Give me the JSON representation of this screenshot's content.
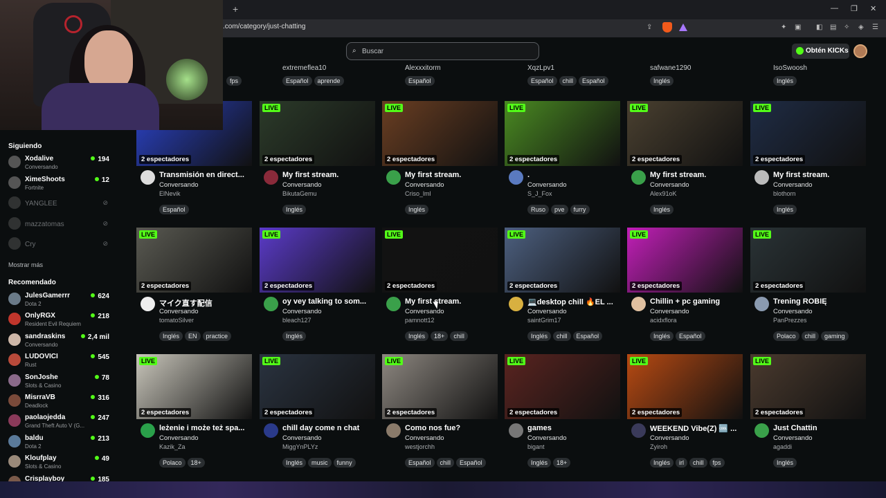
{
  "browser": {
    "url": ".com/category/just-chatting",
    "new_tab": "+",
    "minimize": "—",
    "maximize": "❐",
    "close": "✕"
  },
  "header": {
    "search_placeholder": "Buscar",
    "search_icon": "search-icon",
    "kicks_button": "Obtén KICKs"
  },
  "sidebar": {
    "following_label": "Siguiendo",
    "following": [
      {
        "name": "Xodalive",
        "category": "Conversando",
        "viewers": "194"
      },
      {
        "name": "XimeShoots",
        "category": "Fortnite",
        "viewers": "12"
      },
      {
        "name": "YANGLEE",
        "offline": true
      },
      {
        "name": "mazzatomas",
        "offline": true
      },
      {
        "name": "Cry",
        "offline": true
      }
    ],
    "show_more": "Mostrar más",
    "recommended_label": "Recomendado",
    "recommended": [
      {
        "name": "JulesGamerrr",
        "category": "Dota 2",
        "viewers": "624"
      },
      {
        "name": "OnlyRGX",
        "category": "Resident Evil Requiem",
        "viewers": "218"
      },
      {
        "name": "sandraskins",
        "category": "Conversando",
        "viewers": "2,4 mil"
      },
      {
        "name": "LUDOVICI",
        "category": "Rust",
        "viewers": "545"
      },
      {
        "name": "SonJoshe",
        "category": "Slots & Casino",
        "viewers": "78"
      },
      {
        "name": "MisrraVB",
        "category": "Deadlock",
        "viewers": "316"
      },
      {
        "name": "paolaojedda",
        "category": "Grand Theft Auto V (G...",
        "viewers": "247"
      },
      {
        "name": "baldu",
        "category": "Dota 2",
        "viewers": "213"
      },
      {
        "name": "Kloufplay",
        "category": "Slots & Casino",
        "viewers": "49"
      },
      {
        "name": "Crisplayboy",
        "category": "",
        "viewers": "185"
      }
    ]
  },
  "top_partial_row": [
    {
      "user": "",
      "tags": [
        "fps"
      ]
    },
    {
      "user": "extremeflea10",
      "tags": [
        "Español",
        "aprende"
      ]
    },
    {
      "user": "Alexxxitorm",
      "tags": [
        "Español"
      ]
    },
    {
      "user": "XqzLpv1",
      "tags": [
        "Español",
        "chill",
        "Español"
      ]
    },
    {
      "user": "safwane1290",
      "tags": [
        "Inglés"
      ]
    },
    {
      "user": "IsoSwoosh",
      "tags": [
        "Inglés"
      ]
    }
  ],
  "live_label": "LIVE",
  "streams": [
    [
      {
        "title": "Transmisión en direct...",
        "category": "Conversando",
        "user": "ElNevik",
        "viewers": "2 espectadores",
        "tags": [
          "Español"
        ],
        "live": false,
        "thumb": "#2b43c9"
      },
      {
        "title": "My first stream.",
        "category": "Conversando",
        "user": "BikutaGemu",
        "viewers": "2 espectadores",
        "tags": [
          "Inglés"
        ],
        "live": true,
        "thumb": "#2c3b2a"
      },
      {
        "title": "My first stream.",
        "category": "Conversando",
        "user": "Criso_lml",
        "viewers": "2 espectadores",
        "tags": [
          "Inglés"
        ],
        "live": true,
        "thumb": "#6a3e22"
      },
      {
        "title": ".",
        "category": "Conversando",
        "user": "S_J_Fox",
        "viewers": "2 espectadores",
        "tags": [
          "Ruso",
          "pve",
          "furry"
        ],
        "live": true,
        "thumb": "#4a8a22"
      },
      {
        "title": "My first stream.",
        "category": "Conversando",
        "user": "Alex91oK",
        "viewers": "2 espectadores",
        "tags": [
          "Inglés"
        ],
        "live": true,
        "thumb": "#4a4030"
      },
      {
        "title": "My first stream.",
        "category": "Conversando",
        "user": "blothorn",
        "viewers": "2 espectadores",
        "tags": [
          "Inglés"
        ],
        "live": true,
        "thumb": "#1f2c45"
      }
    ],
    [
      {
        "title": "マイク直す配信",
        "category": "Conversando",
        "user": "tomatoSilver",
        "viewers": "2 espectadores",
        "tags": [
          "Inglés",
          "EN",
          "practice"
        ],
        "live": true,
        "thumb": "#5a5a52"
      },
      {
        "title": "oy vey talking to som...",
        "category": "Conversando",
        "user": "bleach127",
        "viewers": "2 espectadores",
        "tags": [
          "Inglés"
        ],
        "live": true,
        "thumb": "#5b3bc9"
      },
      {
        "title": "My first stream.",
        "category": "Conversando",
        "user": "pamnott12",
        "viewers": "2 espectadores",
        "tags": [
          "Inglés",
          "18+",
          "chill"
        ],
        "live": true,
        "thumb": "#121212"
      },
      {
        "title": "💻desktop chill 🔥EL ...",
        "category": "Conversando",
        "user": "saintGrim17",
        "viewers": "2 espectadores",
        "tags": [
          "Inglés",
          "chill",
          "Español"
        ],
        "live": true,
        "thumb": "#4d6080"
      },
      {
        "title": "Chillin + pc gaming",
        "category": "Conversando",
        "user": "acidxflora",
        "viewers": "2 espectadores",
        "tags": [
          "Inglés",
          "Español"
        ],
        "live": true,
        "thumb": "#c21fb8"
      },
      {
        "title": "Trening ROBIĘ",
        "category": "Conversando",
        "user": "PanPrezzes",
        "viewers": "2 espectadores",
        "tags": [
          "Polaco",
          "chill",
          "gaming"
        ],
        "live": true,
        "thumb": "#2a3336"
      }
    ],
    [
      {
        "title": "leżenie i może też spa...",
        "category": "Conversando",
        "user": "Kazik_Za",
        "viewers": "2 espectadores",
        "tags": [
          "Polaco",
          "18+"
        ],
        "live": true,
        "thumb": "#c9c6bb"
      },
      {
        "title": "chill day come n chat",
        "category": "Conversando",
        "user": "MiggYnPLYz",
        "viewers": "2 espectadores",
        "tags": [
          "Inglés",
          "music",
          "funny"
        ],
        "live": true,
        "thumb": "#2a3340"
      },
      {
        "title": "Como nos fue?",
        "category": "Conversando",
        "user": "westjorchh",
        "viewers": "2 espectadores",
        "tags": [
          "Español",
          "chill",
          "Español"
        ],
        "live": true,
        "thumb": "#8d8780"
      },
      {
        "title": "games",
        "category": "Conversando",
        "user": "bigant",
        "viewers": "2 espectadores",
        "tags": [
          "Inglés",
          "18+"
        ],
        "live": true,
        "thumb": "#5a2420"
      },
      {
        "title": "WEEKEND Vibe(Z) 🆒 ...",
        "category": "Conversando",
        "user": "Zyiroh",
        "viewers": "2 espectadores",
        "tags": [
          "Inglés",
          "irl",
          "chill",
          "fps"
        ],
        "live": true,
        "thumb": "#b84a12"
      },
      {
        "title": "Just Chattin",
        "category": "Conversando",
        "user": "agaddi",
        "viewers": "2 espectadores",
        "tags": [
          "Inglés"
        ],
        "live": true,
        "thumb": "#4a3a2e"
      }
    ]
  ],
  "colors": {
    "accent": "#53fc18",
    "background": "#0b0e0f",
    "tag_bg": "#2a2e31"
  }
}
